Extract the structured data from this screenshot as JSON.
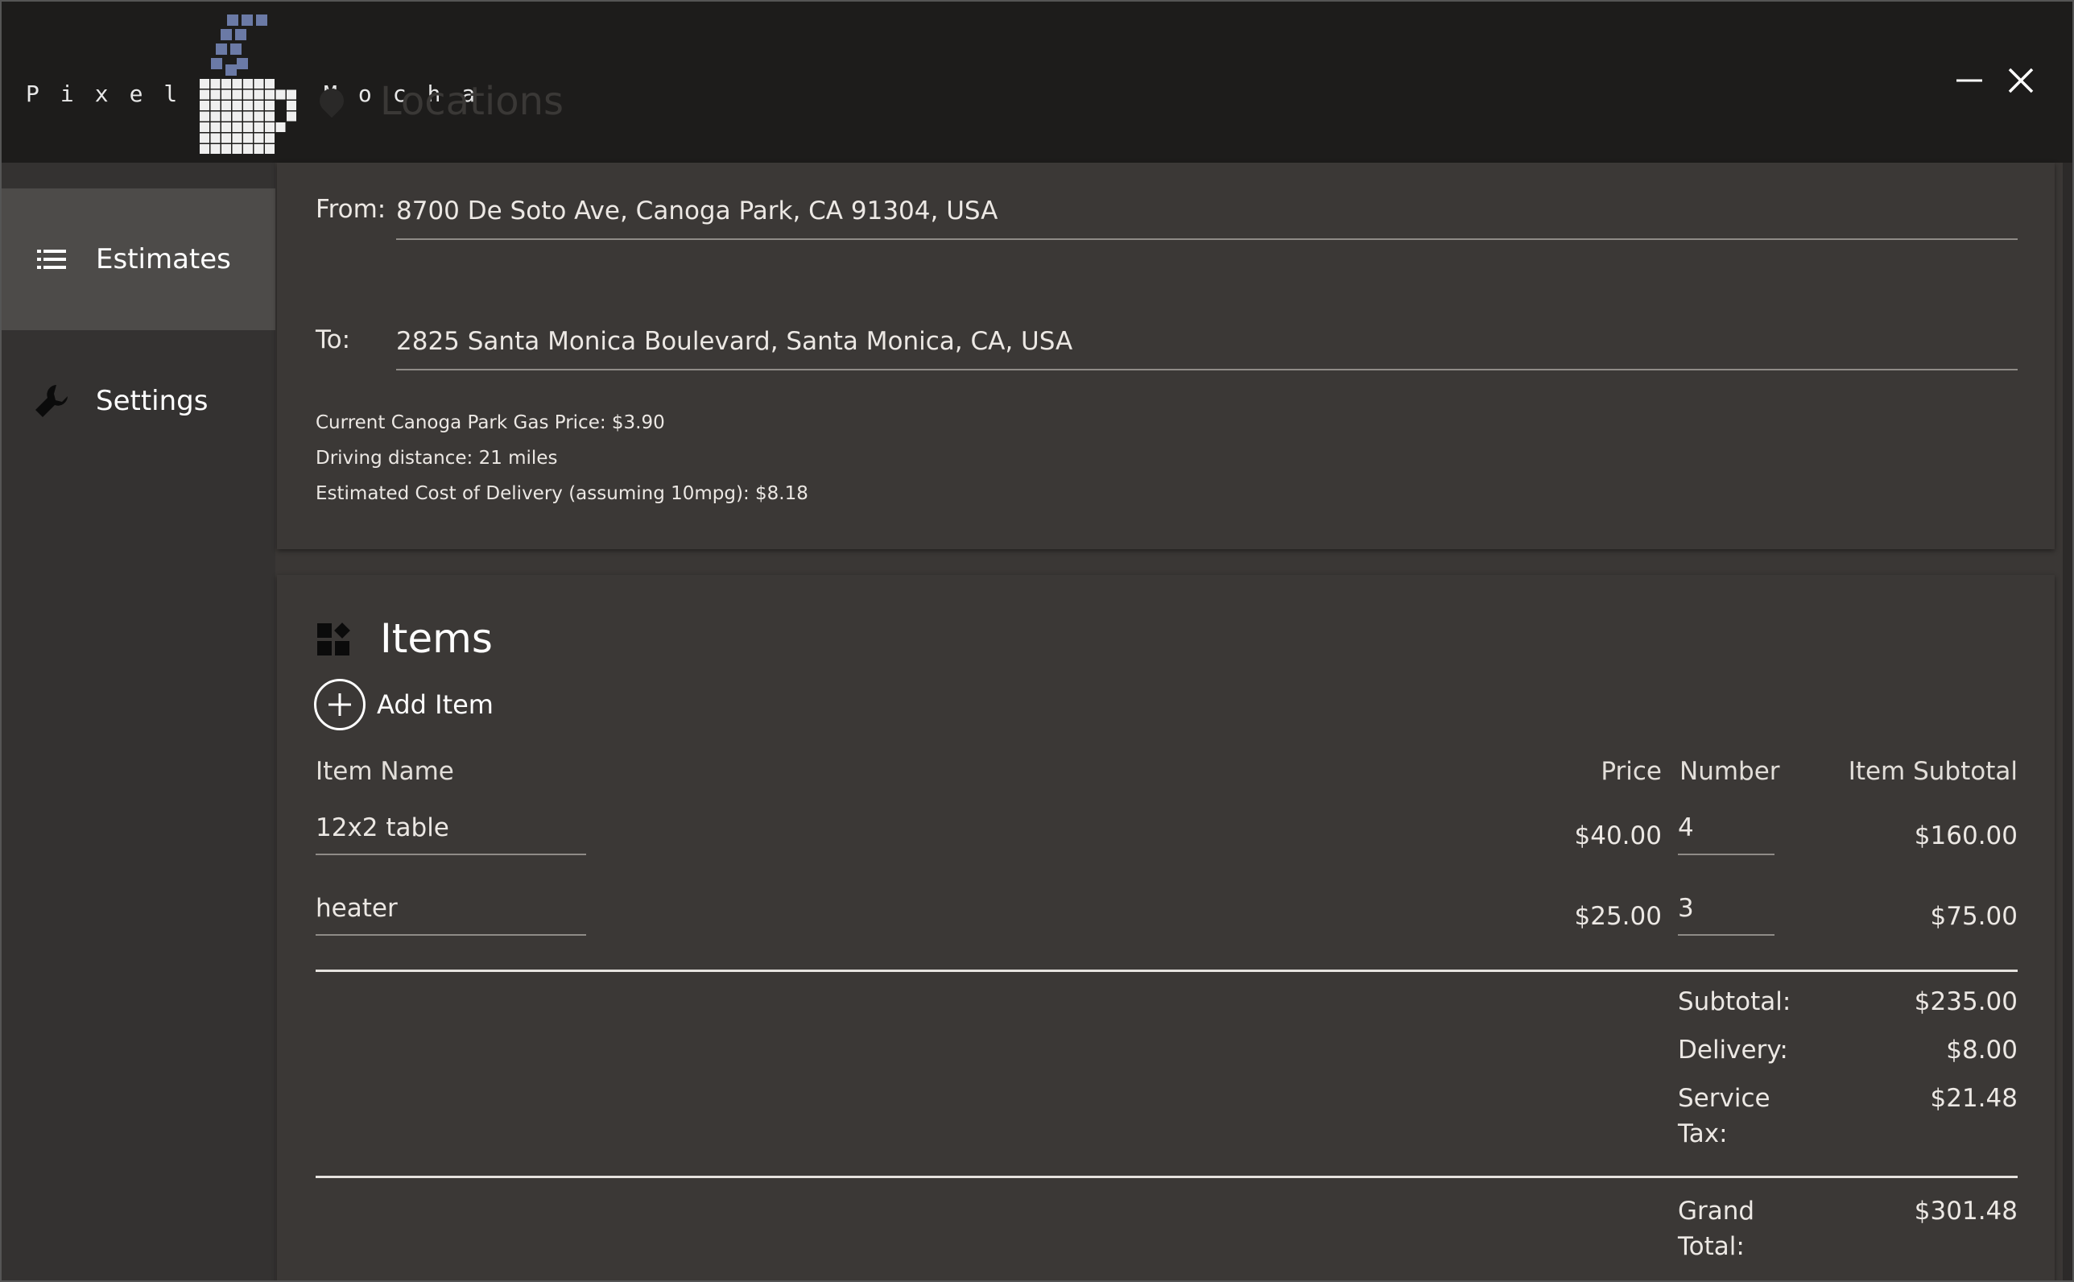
{
  "app": {
    "logo_left": "Pixel",
    "logo_right": "Mocha",
    "ghost_title": "Locations"
  },
  "window_controls": {
    "minimize_icon": "minimize-icon",
    "close_icon": "close-icon"
  },
  "sidebar": {
    "items": [
      {
        "label": "Estimates",
        "icon": "list-icon",
        "active": true
      },
      {
        "label": "Settings",
        "icon": "wrench-icon",
        "active": false
      }
    ]
  },
  "locations": {
    "from_label": "From:",
    "from_value": "8700 De Soto Ave, Canoga Park, CA 91304, USA",
    "to_label": "To:",
    "to_value": "2825 Santa Monica Boulevard, Santa Monica, CA, USA",
    "gas_price": "Current Canoga Park Gas Price: $3.90",
    "distance": "Driving distance: 21 miles",
    "delivery_cost": "Estimated Cost of Delivery (assuming 10mpg): $8.18"
  },
  "items": {
    "title": "Items",
    "title_icon": "dashboard-icon",
    "add_label": "Add Item",
    "add_icon": "plus-circle-icon",
    "columns": {
      "name": "Item Name",
      "price": "Price",
      "number": "Number",
      "subtotal": "Item Subtotal"
    },
    "rows": [
      {
        "name": "12x2 table",
        "price": "$40.00",
        "number": "4",
        "subtotal": "$160.00"
      },
      {
        "name": "heater",
        "price": "$25.00",
        "number": "3",
        "subtotal": "$75.00"
      }
    ]
  },
  "totals": {
    "subtotal_label": "Subtotal:",
    "subtotal_value": "$235.00",
    "delivery_label": "Delivery:",
    "delivery_value": "$8.00",
    "tax_label": "Service Tax:",
    "tax_value": "$21.48",
    "grand_label": "Grand Total:",
    "grand_value": "$301.48"
  },
  "colors": {
    "titlebar": "#1d1c1b",
    "sidebar": "#343231",
    "sidebar_active": "#4d4b49",
    "card": "#3b3836",
    "text": "#ece8e4",
    "logo_accent": "#6b7aa6"
  }
}
